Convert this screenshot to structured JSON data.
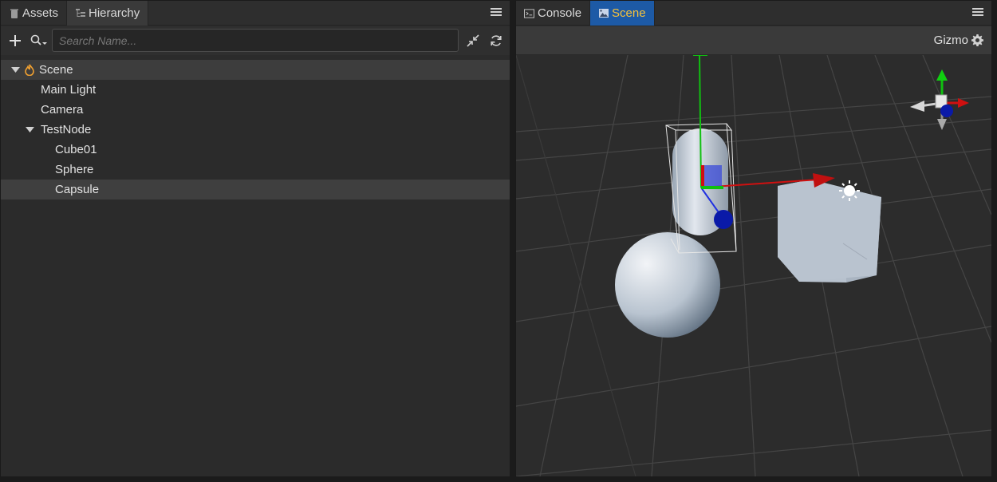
{
  "left_panel": {
    "tabs": [
      {
        "label": "Assets",
        "icon": "trash-icon"
      },
      {
        "label": "Hierarchy",
        "icon": "hierarchy-icon"
      }
    ],
    "search": {
      "placeholder": "Search Name..."
    },
    "tree": [
      {
        "label": "Scene",
        "depth": 0,
        "expanded": true,
        "icon": "scene-flame-icon"
      },
      {
        "label": "Main Light",
        "depth": 1
      },
      {
        "label": "Camera",
        "depth": 1
      },
      {
        "label": "TestNode",
        "depth": 1,
        "expanded": true
      },
      {
        "label": "Cube01",
        "depth": 2
      },
      {
        "label": "Sphere",
        "depth": 2
      },
      {
        "label": "Capsule",
        "depth": 2,
        "selected": true
      }
    ]
  },
  "right_panel": {
    "tabs": [
      {
        "label": "Console",
        "icon": "console-icon"
      },
      {
        "label": "Scene",
        "icon": "scene-icon",
        "active": true
      }
    ],
    "gizmo_label": "Gizmo"
  },
  "colors": {
    "scene_tab_bg": "#1d5aa6",
    "scene_tab_text": "#f7c23a",
    "scene_icon": "#f0a030",
    "axis_x": "#d01010",
    "axis_y": "#10c010",
    "axis_z": "#1010c0"
  }
}
